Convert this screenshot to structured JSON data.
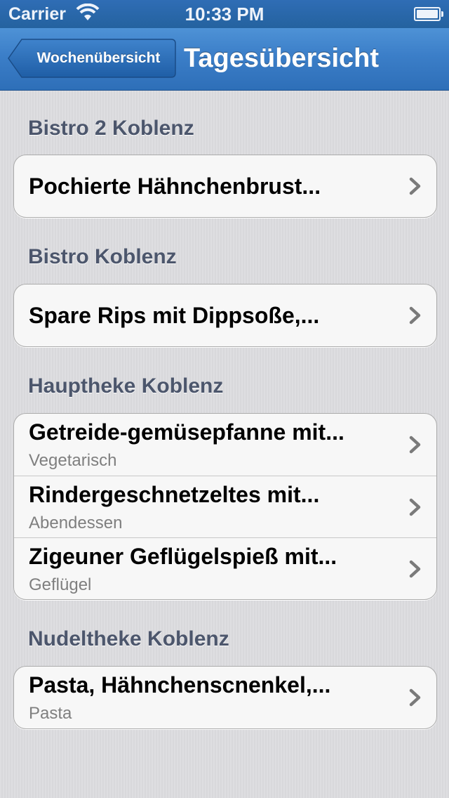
{
  "status_bar": {
    "carrier": "Carrier",
    "time": "10:33 PM",
    "wifi_icon": "wifi-icon",
    "battery_icon": "battery-icon"
  },
  "nav": {
    "back_label": "Wochenübersicht",
    "title": "Tagesübersicht"
  },
  "sections": [
    {
      "header": "Bistro 2 Koblenz",
      "items": [
        {
          "title": "Pochierte Hähnchenbrust..."
        }
      ]
    },
    {
      "header": "Bistro Koblenz",
      "items": [
        {
          "title": "Spare Rips mit Dippsoße,..."
        }
      ]
    },
    {
      "header": "Hauptheke Koblenz",
      "items": [
        {
          "title": "Getreide-gemüsepfanne mit...",
          "subtitle": "Vegetarisch"
        },
        {
          "title": "Rindergeschnetzeltes mit...",
          "subtitle": "Abendessen"
        },
        {
          "title": "Zigeuner Geflügelspieß mit...",
          "subtitle": "Geflügel"
        }
      ]
    },
    {
      "header": "Nudeltheke Koblenz",
      "items": [
        {
          "title": "Pasta, Hähnchenscnenkel,...",
          "subtitle": "Pasta"
        }
      ]
    }
  ],
  "colors": {
    "nav_blue": "#3b7ec8",
    "background": "#dcdcdf",
    "section_header": "#4c566c",
    "subtitle": "#7f7f7f"
  }
}
